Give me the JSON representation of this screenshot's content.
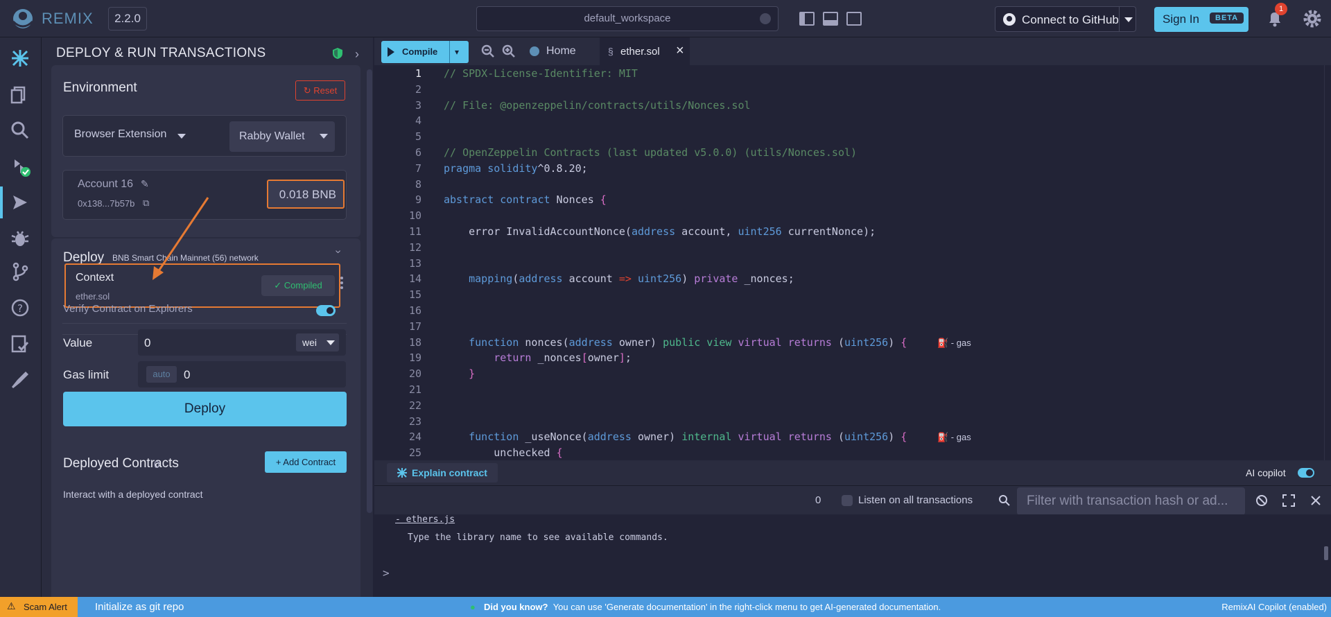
{
  "app": {
    "brand": "REMIX",
    "version": "2.2.0",
    "workspace": "default_workspace",
    "connect_github": "Connect to GitHub",
    "sign_in": "Sign In",
    "beta": "BETA",
    "notifications": "1"
  },
  "panel": {
    "title": "DEPLOY & RUN TRANSACTIONS",
    "environment_label": "Environment",
    "reset_label": "Reset",
    "environment_value": "Browser Extension",
    "wallet_value": "Rabby Wallet",
    "account_name": "Account 16",
    "account_address": "0x138...7b57b",
    "account_balance": "0.018 BNB",
    "deploy_label": "Deploy",
    "network": "BNB Smart Chain Mainnet (56) network",
    "context_title": "Context",
    "context_file": "ether.sol",
    "compiled_badge": "✓ Compiled",
    "verify_label": "Verify Contract on Explorers",
    "value_label": "Value",
    "value_input": "0",
    "value_unit": "wei",
    "gas_label": "Gas limit",
    "gas_auto": "auto",
    "gas_input": "0",
    "deploy_button": "Deploy",
    "deployed_title": "Deployed Contracts",
    "deployed_count": "0",
    "add_contract": "+ Add Contract",
    "interact_text": "Interact with a deployed contract"
  },
  "editor": {
    "compile_label": "Compile",
    "home_tab": "Home",
    "file_tab": "ether.sol",
    "gas_hint": "- gas",
    "line_numbers": [
      "1",
      "2",
      "3",
      "4",
      "5",
      "6",
      "7",
      "8",
      "9",
      "10",
      "11",
      "12",
      "13",
      "14",
      "15",
      "16",
      "17",
      "18",
      "19",
      "20",
      "21",
      "22",
      "23",
      "24",
      "25"
    ]
  },
  "explain": {
    "button": "Explain contract",
    "copilot": "AI copilot"
  },
  "terminal": {
    "count": "0",
    "listen_label": "Listen on all transactions",
    "filter_placeholder": "Filter with transaction hash or ad...",
    "line1": "- ethers.js",
    "line2": "Type the library name to see available commands.",
    "prompt": ">"
  },
  "status": {
    "scam_alert": "Scam Alert",
    "git_init": "Initialize as git repo",
    "did_you_know": "Did you know?",
    "tip": "You can use 'Generate documentation' in the right-click menu to get AI-generated documentation.",
    "remixai": "RemixAI Copilot (enabled)"
  },
  "colors": {
    "accent": "#5bc4ec",
    "highlight": "#e67a33",
    "danger": "#e0432f",
    "success": "#2fbf71"
  }
}
